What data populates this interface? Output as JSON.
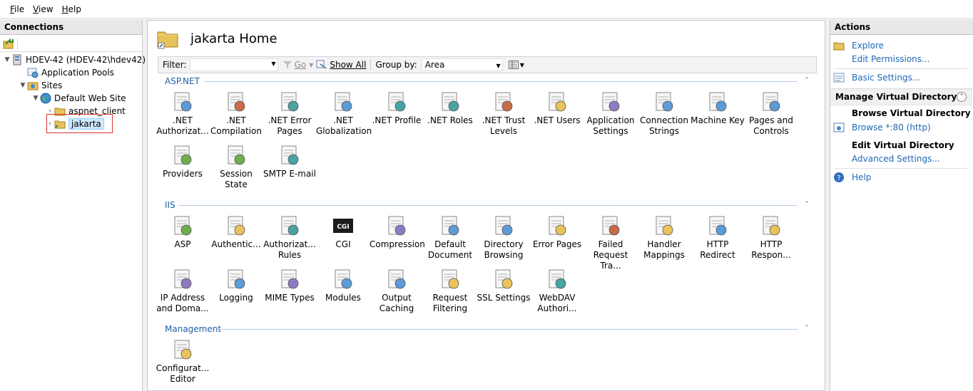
{
  "menu": {
    "file": "File",
    "view": "View",
    "help": "Help"
  },
  "connections": {
    "title": "Connections",
    "tree": {
      "server": "HDEV-42 (HDEV-42\\hdev42)",
      "app_pools": "Application Pools",
      "sites": "Sites",
      "default_site": "Default Web Site",
      "aspnet_client": "aspnet_client",
      "jakarta": "jakarta"
    }
  },
  "home": {
    "title": "jakarta Home",
    "filter_label": "Filter:",
    "filter_value": "",
    "go_label": "Go",
    "show_all_label": "Show All",
    "group_by_label": "Group by:",
    "group_by_value": "Area"
  },
  "groups": {
    "aspnet": {
      "title": "ASP.NET",
      "items": [
        {
          "l1": ".NET",
          "l2": "Authorizat...",
          "icon": "authorization-lock-icon"
        },
        {
          "l1": ".NET",
          "l2": "Compilation",
          "icon": "compilation-icon"
        },
        {
          "l1": ".NET Error",
          "l2": "Pages",
          "icon": "error-page-404-icon"
        },
        {
          "l1": ".NET",
          "l2": "Globalization",
          "icon": "globe-icon"
        },
        {
          "l1": ".NET Profile",
          "l2": "",
          "icon": "profile-icon"
        },
        {
          "l1": ".NET Roles",
          "l2": "",
          "icon": "roles-icon"
        },
        {
          "l1": ".NET Trust",
          "l2": "Levels",
          "icon": "trust-globe-check-icon"
        },
        {
          "l1": ".NET Users",
          "l2": "",
          "icon": "users-icon"
        },
        {
          "l1": "Application",
          "l2": "Settings",
          "icon": "settings-list-icon"
        },
        {
          "l1": "Connection",
          "l2": "Strings",
          "icon": "database-ab-icon"
        },
        {
          "l1": "Machine Key",
          "l2": "",
          "icon": "server-key-icon"
        },
        {
          "l1": "Pages and",
          "l2": "Controls",
          "icon": "pages-controls-icon"
        },
        {
          "l1": "Providers",
          "l2": "",
          "icon": "providers-icon"
        },
        {
          "l1": "Session State",
          "l2": "",
          "icon": "session-state-icon"
        },
        {
          "l1": "SMTP E-mail",
          "l2": "",
          "icon": "smtp-email-icon"
        }
      ]
    },
    "iis": {
      "title": "IIS",
      "items": [
        {
          "l1": "ASP",
          "l2": "",
          "icon": "asp-icon"
        },
        {
          "l1": "Authentic...",
          "l2": "",
          "icon": "authentication-icon"
        },
        {
          "l1": "Authorizat...",
          "l2": "Rules",
          "icon": "authorization-rules-icon"
        },
        {
          "l1": "CGI",
          "l2": "",
          "icon": "cgi-icon",
          "badge": "CGI"
        },
        {
          "l1": "Compression",
          "l2": "",
          "icon": "compression-icon"
        },
        {
          "l1": "Default",
          "l2": "Document",
          "icon": "default-document-icon"
        },
        {
          "l1": "Directory",
          "l2": "Browsing",
          "icon": "directory-browsing-icon"
        },
        {
          "l1": "Error Pages",
          "l2": "",
          "icon": "error-pages-404-icon"
        },
        {
          "l1": "Failed",
          "l2": "Request Tra...",
          "icon": "failed-request-icon"
        },
        {
          "l1": "Handler",
          "l2": "Mappings",
          "icon": "handler-mappings-icon"
        },
        {
          "l1": "HTTP",
          "l2": "Redirect",
          "icon": "http-redirect-icon"
        },
        {
          "l1": "HTTP",
          "l2": "Respon...",
          "icon": "http-response-icon"
        },
        {
          "l1": "IP Address",
          "l2": "and Doma...",
          "icon": "ip-address-icon"
        },
        {
          "l1": "Logging",
          "l2": "",
          "icon": "logging-icon"
        },
        {
          "l1": "MIME Types",
          "l2": "",
          "icon": "mime-types-icon"
        },
        {
          "l1": "Modules",
          "l2": "",
          "icon": "modules-icon"
        },
        {
          "l1": "Output",
          "l2": "Caching",
          "icon": "output-caching-icon"
        },
        {
          "l1": "Request",
          "l2": "Filtering",
          "icon": "request-filtering-icon"
        },
        {
          "l1": "SSL Settings",
          "l2": "",
          "icon": "ssl-lock-icon"
        },
        {
          "l1": "WebDAV",
          "l2": "Authori...",
          "icon": "webdav-icon",
          "badge": "DAV"
        }
      ]
    },
    "management": {
      "title": "Management",
      "items": [
        {
          "l1": "Configurat...",
          "l2": "Editor",
          "icon": "configuration-editor-icon"
        }
      ]
    }
  },
  "actions": {
    "title": "Actions",
    "explore": "Explore",
    "edit_permissions": "Edit Permissions...",
    "basic_settings": "Basic Settings...",
    "manage_title": "Manage Virtual Directory",
    "browse_title": "Browse Virtual Directory",
    "browse_link": "Browse *:80 (http)",
    "edit_title": "Edit Virtual Directory",
    "advanced_settings": "Advanced Settings...",
    "help": "Help"
  },
  "colors": {
    "link": "#1f67b5",
    "group_header": "#1f5fa6",
    "selection_outline": "#d9332c",
    "folder": "#e8c25a"
  }
}
